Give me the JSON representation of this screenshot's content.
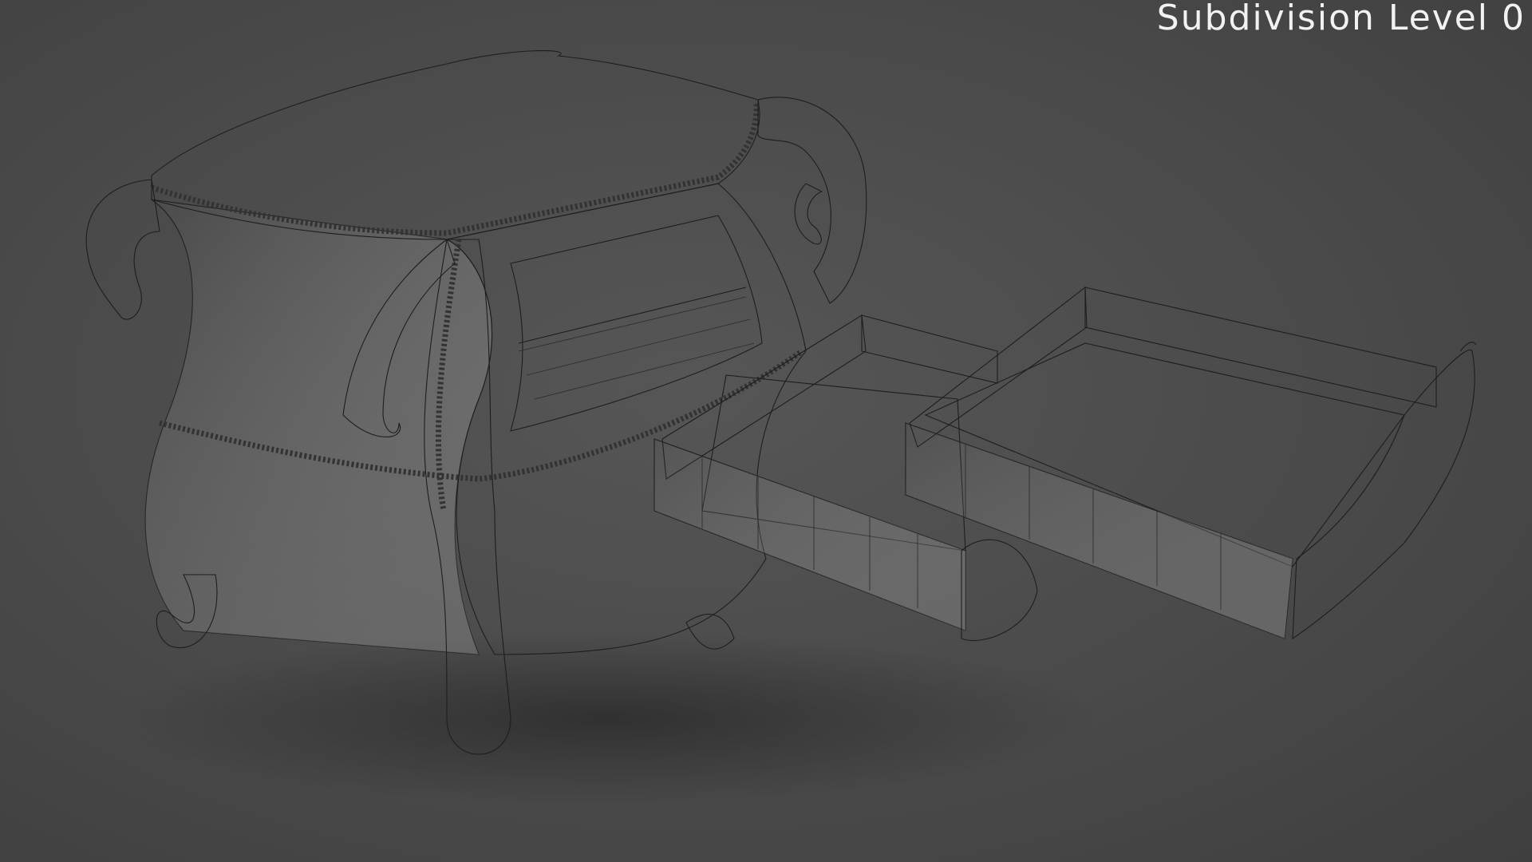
{
  "viewport": {
    "overlay_label": "Subdivision Level 0"
  },
  "icons": {
    "model": "nightstand-wireframe-render"
  },
  "colors": {
    "background": "#4a4a4a",
    "surface": "#eeeeee",
    "wire": "#1e1e1e",
    "label": "#f2f2f2"
  }
}
